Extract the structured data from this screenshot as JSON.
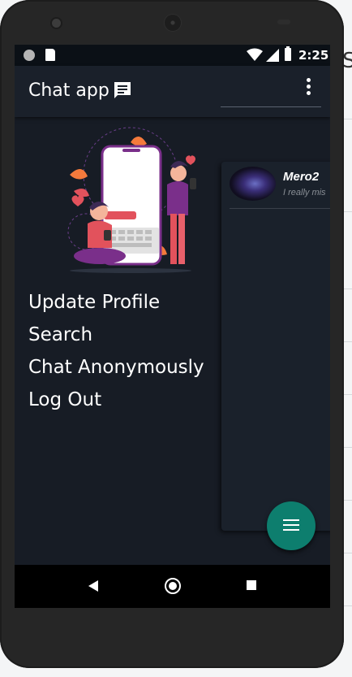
{
  "status_bar": {
    "time": "2:25",
    "icons": [
      "notification-circle-icon",
      "sd-card-icon",
      "wifi-icon",
      "signal-icon",
      "battery-icon"
    ]
  },
  "app_bar": {
    "title": "Chat app",
    "icons": [
      "chat-icon",
      "more-vert-icon"
    ]
  },
  "drawer": {
    "menu": [
      {
        "label": "Update Profile"
      },
      {
        "label": "Search"
      },
      {
        "label": "Chat Anonymously"
      },
      {
        "label": "Log Out"
      }
    ]
  },
  "chats": [
    {
      "name": "Mero2",
      "message": "I really mis"
    }
  ],
  "fab": {
    "icon": "menu-icon"
  },
  "nav_bar": {
    "icons": [
      "back-icon",
      "home-icon",
      "recents-icon"
    ]
  },
  "colors": {
    "screen_bg": "#171c25",
    "app_bar": "#1a202a",
    "fab": "#0d7e6e",
    "status_bar": "#0b1016"
  }
}
